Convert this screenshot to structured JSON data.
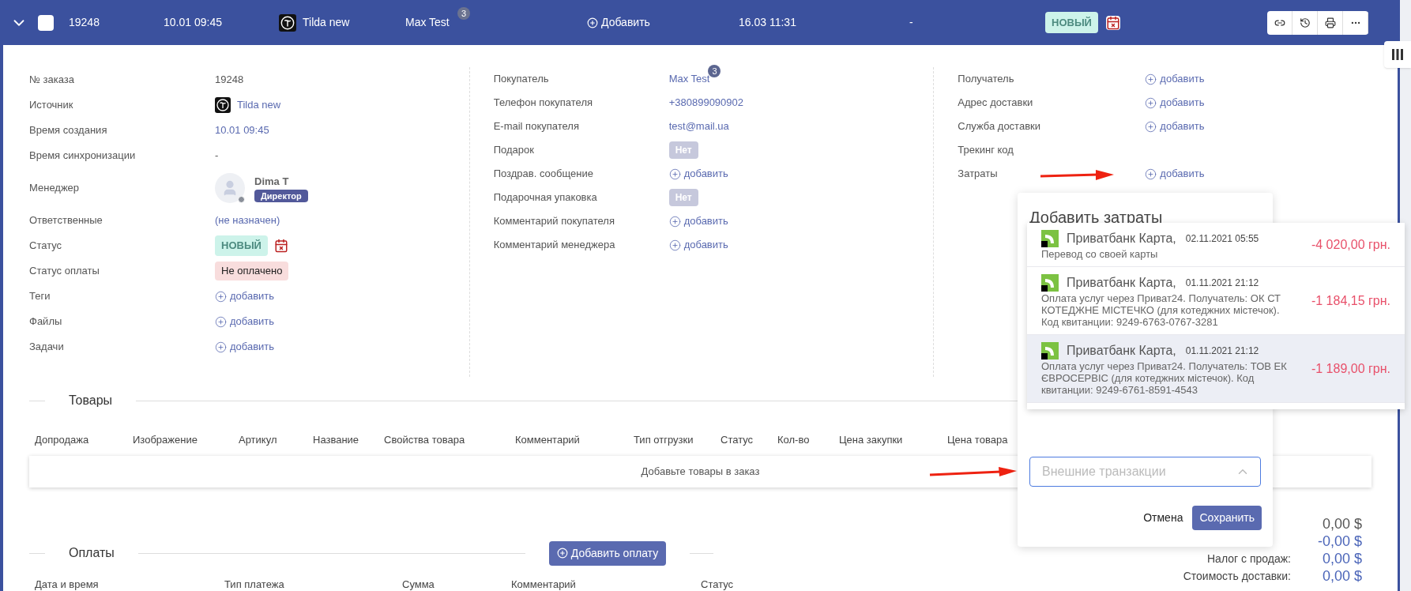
{
  "header": {
    "expanded": true,
    "checked": false,
    "order_id": "19248",
    "created": "10.01 09:45",
    "source": "Tilda new",
    "customer": "Max Test",
    "customer_count": "3",
    "add_label": "Добавить",
    "date": "16.03 11:31",
    "dash": "-",
    "status": "НОВЫЙ"
  },
  "columns": [
    {
      "rows": [
        {
          "label": "№ заказа",
          "kind": "text",
          "value": "19248"
        },
        {
          "label": "Источник",
          "kind": "source",
          "value": "Tilda new"
        },
        {
          "label": "Время создания",
          "kind": "link",
          "value": "10.01 09:45"
        },
        {
          "label": "Время синхронизации",
          "kind": "text",
          "value": "-"
        },
        {
          "label": "Менеджер",
          "kind": "manager",
          "value": "Dima T",
          "role": "Директор"
        },
        {
          "label": "Ответственные",
          "kind": "link",
          "value": "(не назначен)"
        },
        {
          "label": "Статус",
          "kind": "status",
          "value": "НОВЫЙ"
        },
        {
          "label": "Статус оплаты",
          "kind": "payment",
          "value": "Не оплачено"
        },
        {
          "label": "Теги",
          "kind": "add",
          "value": "добавить"
        },
        {
          "label": "Файлы",
          "kind": "add",
          "value": "добавить"
        },
        {
          "label": "Задачи",
          "kind": "add",
          "value": "добавить"
        }
      ]
    },
    {
      "rows": [
        {
          "label": "Покупатель",
          "kind": "customer",
          "value": "Max Test",
          "count": "3"
        },
        {
          "label": "Телефон покупателя",
          "kind": "link",
          "value": "+380899090902"
        },
        {
          "label": "E-mail покупателя",
          "kind": "link",
          "value": "test@mail.ua"
        },
        {
          "label": "Подарок",
          "kind": "toggle",
          "value": "Нет",
          "on": false
        },
        {
          "label": "Поздрав. сообщение",
          "kind": "add",
          "value": "добавить"
        },
        {
          "label": "Подарочная упаковка",
          "kind": "toggle",
          "value": "Нет",
          "on": false
        },
        {
          "label": "Комментарий покупателя",
          "kind": "add",
          "value": "добавить"
        },
        {
          "label": "Комментарий менеджера",
          "kind": "add",
          "value": "добавить"
        }
      ]
    },
    {
      "rows": [
        {
          "label": "Получатель",
          "kind": "add",
          "value": "добавить"
        },
        {
          "label": "Адрес доставки",
          "kind": "add",
          "value": "добавить"
        },
        {
          "label": "Служба доставки",
          "kind": "add",
          "value": "добавить"
        },
        {
          "label": "Трекинг код",
          "kind": "empty"
        },
        {
          "label": "Затраты",
          "kind": "add",
          "value": "добавить"
        }
      ]
    }
  ],
  "products": {
    "title": "Товары",
    "columns": [
      "Допродажа",
      "Изображение",
      "Артикул",
      "Название",
      "Свойства товара",
      "Комментарий",
      "Тип отгрузки",
      "Статус",
      "Кол-во",
      "Цена закупки",
      "Цена товара"
    ],
    "empty_text": "Добавьте товары в заказ"
  },
  "payments": {
    "title": "Оплаты",
    "add_button": "Добавить оплату",
    "columns": [
      "Дата и время",
      "Тип платежа",
      "Сумма",
      "Комментарий",
      "Статус"
    ]
  },
  "totals": [
    {
      "kind": "plain",
      "value": "0,00 $"
    },
    {
      "kind": "link",
      "value": "-0,00 $"
    },
    {
      "kind": "link",
      "label": "Налог с продаж:",
      "value": "0,00 $"
    },
    {
      "kind": "link",
      "label": "Стоимость доставки:",
      "value": "0,00 $"
    }
  ],
  "popup": {
    "title": "Добавить затраты",
    "transactions": [
      {
        "bank": "Приватбанк Карта,",
        "date": "02.11.2021 05:55",
        "description": "Перевод со своей карты",
        "amount": "-4 020,00 грн.",
        "selected": false
      },
      {
        "bank": "Приватбанк Карта,",
        "date": "01.11.2021 21:12",
        "description": "Оплата услуг через Приват24. Получатель: ОК СТ КОТЕДЖНЕ МІСТЕЧКО (для котеджних містечок). Код квитанции: 9249-6763-0767-3281",
        "amount": "-1 184,15 грн.",
        "selected": false
      },
      {
        "bank": "Приватбанк Карта,",
        "date": "01.11.2021 21:12",
        "description": "Оплата услуг через Приват24. Получатель: ТОВ ЕК ЄВРОСЕРВІС (для котеджних містечок). Код квитанции: 9249-6761-8591-4543",
        "amount": "-1 189,00 грн.",
        "selected": true
      }
    ],
    "select_placeholder": "Внешние транзакции",
    "cancel": "Отмена",
    "save": "Сохранить"
  }
}
